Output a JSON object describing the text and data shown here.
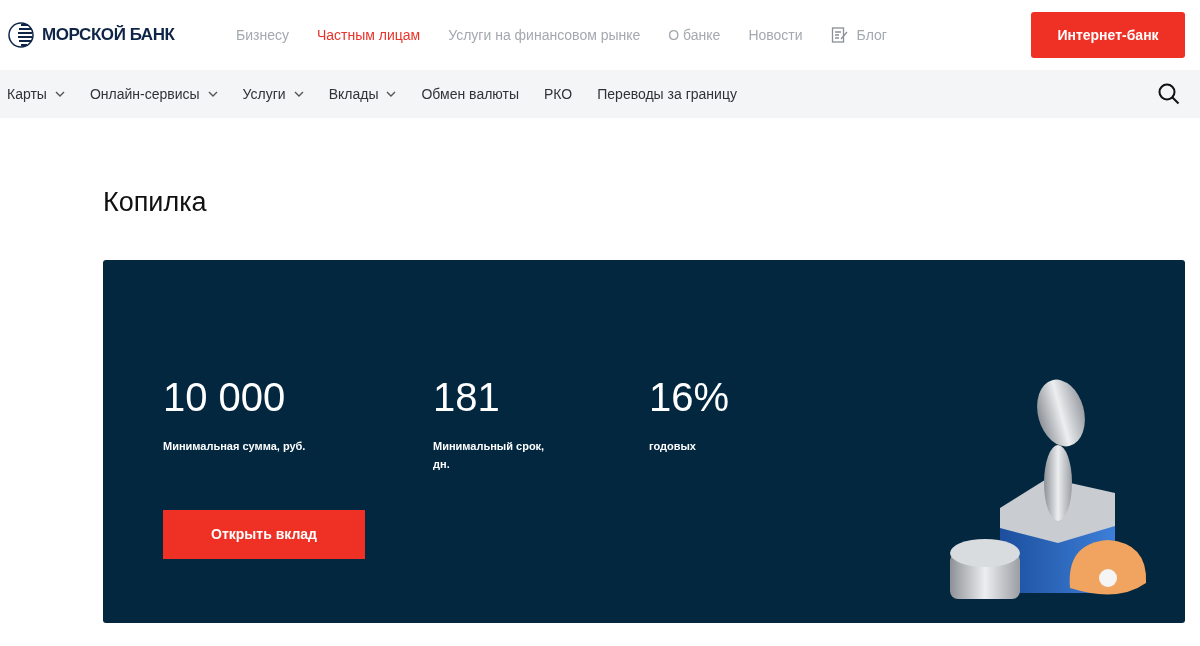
{
  "header": {
    "logo": "МОРСКОЙ БАНК",
    "nav": [
      {
        "label": "Бизнесу",
        "selected": false,
        "kind": "link"
      },
      {
        "label": "Частным лицам",
        "selected": true,
        "kind": "link"
      },
      {
        "label": "Услуги на финансовом рынке",
        "selected": false,
        "kind": "link"
      },
      {
        "label": "О банке",
        "selected": false,
        "kind": "link"
      },
      {
        "label": "Новости",
        "selected": false,
        "kind": "link"
      },
      {
        "label": "Блог",
        "selected": false,
        "kind": "blog"
      }
    ],
    "button": "Интернет-банк"
  },
  "subnav": [
    {
      "label": "Карты",
      "dropdown": true
    },
    {
      "label": "Онлайн-сервисы",
      "dropdown": true
    },
    {
      "label": "Услуги",
      "dropdown": true
    },
    {
      "label": "Вклады",
      "dropdown": true
    },
    {
      "label": "Обмен валюты",
      "dropdown": false
    },
    {
      "label": "РКО",
      "dropdown": false
    },
    {
      "label": "Переводы за границу",
      "dropdown": false
    }
  ],
  "page_title": "Копилка",
  "offer": {
    "stats": [
      {
        "value": "10 000",
        "caption": "Минимальная сумма, руб."
      },
      {
        "value": "181",
        "caption": "Минимальный срок, дн."
      },
      {
        "value": "16%",
        "caption": "годовых"
      }
    ],
    "button": "Открыть вклад"
  }
}
